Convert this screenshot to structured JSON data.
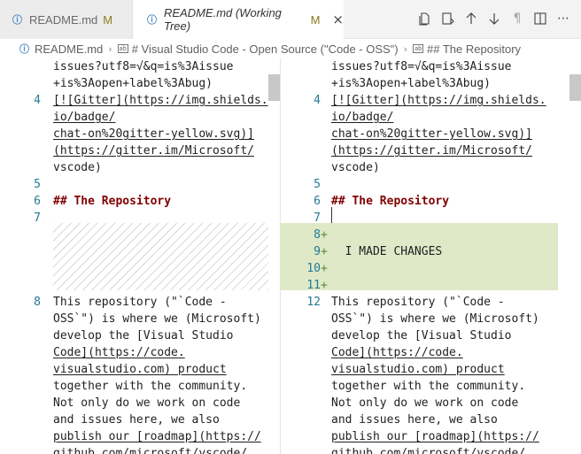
{
  "tabs": [
    {
      "label": "README.md",
      "modified": "M",
      "icon": "markdown-icon",
      "close": ""
    },
    {
      "label": "README.md (Working Tree)",
      "modified": "M",
      "icon": "markdown-icon",
      "close": "×"
    }
  ],
  "actions": [
    "open-file-icon",
    "open-changes-icon",
    "arrow-up-icon",
    "arrow-down-icon",
    "pilcrow-icon",
    "split-editor-icon",
    "more-icon"
  ],
  "breadcrumb": {
    "file": "README.md",
    "section1": "# Visual Studio Code - Open Source (\"Code - OSS\")",
    "section2": "## The Repository"
  },
  "left": {
    "lines": [
      {
        "num": "",
        "text": "issues?utf8=√&q=is%3Aissue"
      },
      {
        "num": "",
        "text": "+is%3Aopen+label%3Abug)"
      },
      {
        "num": "4",
        "text": "[![Gitter](https://img.shields."
      },
      {
        "num": "",
        "text": "io/badge/"
      },
      {
        "num": "",
        "text": "chat-on%20gitter-yellow.svg)]"
      },
      {
        "num": "",
        "text": "(https://gitter.im/Microsoft/"
      },
      {
        "num": "",
        "text": "vscode)"
      },
      {
        "num": "5",
        "text": ""
      },
      {
        "num": "6",
        "text": "## The Repository"
      },
      {
        "num": "7",
        "text": ""
      },
      {
        "num": "8",
        "text": "This repository (\"`Code -"
      },
      {
        "num": "",
        "text": "OSS`\") is where we (Microsoft)"
      },
      {
        "num": "",
        "text": "develop the [Visual Studio"
      },
      {
        "num": "",
        "text": "Code](https://code."
      },
      {
        "num": "",
        "text": "visualstudio.com) product"
      },
      {
        "num": "",
        "text": "together with the community."
      },
      {
        "num": "",
        "text": "Not only do we work on code"
      },
      {
        "num": "",
        "text": "and issues here, we also"
      },
      {
        "num": "",
        "text": "publish our [roadmap](https://"
      },
      {
        "num": "",
        "text": "github.com/microsoft/vscode/"
      }
    ]
  },
  "right": {
    "lines": [
      {
        "num": "",
        "text": "issues?utf8=√&q=is%3Aissue"
      },
      {
        "num": "",
        "text": "+is%3Aopen+label%3Abug)"
      },
      {
        "num": "4",
        "text": "[![Gitter](https://img.shields."
      },
      {
        "num": "",
        "text": "io/badge/"
      },
      {
        "num": "",
        "text": "chat-on%20gitter-yellow.svg)]"
      },
      {
        "num": "",
        "text": "(https://gitter.im/Microsoft/"
      },
      {
        "num": "",
        "text": "vscode)"
      },
      {
        "num": "5",
        "text": ""
      },
      {
        "num": "6",
        "text": "## The Repository"
      },
      {
        "num": "7",
        "text": ""
      },
      {
        "num": "8",
        "text": ""
      },
      {
        "num": "9",
        "text": "  I MADE CHANGES"
      },
      {
        "num": "10",
        "text": ""
      },
      {
        "num": "11",
        "text": ""
      },
      {
        "num": "12",
        "text": "This repository (\"`Code -"
      },
      {
        "num": "",
        "text": "OSS`\") is where we (Microsoft)"
      },
      {
        "num": "",
        "text": "develop the [Visual Studio"
      },
      {
        "num": "",
        "text": "Code](https://code."
      },
      {
        "num": "",
        "text": "visualstudio.com) product"
      },
      {
        "num": "",
        "text": "together with the community."
      },
      {
        "num": "",
        "text": "Not only do we work on code"
      },
      {
        "num": "",
        "text": "and issues here, we also"
      },
      {
        "num": "",
        "text": "publish our [roadmap](https://"
      },
      {
        "num": "",
        "text": "github.com/microsoft/vscode/"
      }
    ],
    "added_marker": "+"
  },
  "colors": {
    "added": "#dfe9c8",
    "gutter": "#237893",
    "heading": "#800000",
    "link": "#a31515"
  }
}
